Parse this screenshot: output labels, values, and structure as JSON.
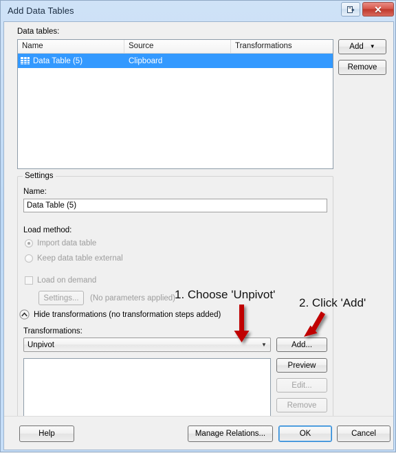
{
  "window": {
    "title": "Add Data Tables",
    "titlebar_buttons": [
      {
        "name": "context-help-button",
        "glyph": "❐"
      },
      {
        "name": "close-button",
        "glyph": "✕"
      }
    ]
  },
  "data_tables": {
    "section_label": "Data tables:",
    "columns": [
      "Name",
      "Source",
      "Transformations"
    ],
    "rows": [
      {
        "name": "Data Table (5)",
        "source": "Clipboard",
        "transformations": "",
        "selected": true
      }
    ],
    "buttons": {
      "add": "Add",
      "add_split_arrow": "▼",
      "remove": "Remove"
    }
  },
  "settings": {
    "group_title": "Settings",
    "name_label": "Name:",
    "name_value": "Data Table (5)",
    "load_method_label": "Load method:",
    "radios": [
      {
        "label": "Import data table",
        "checked": true,
        "disabled": true
      },
      {
        "label": "Keep data table external",
        "checked": false,
        "disabled": true
      }
    ],
    "load_on_demand": {
      "label": "Load on demand",
      "checked": false,
      "disabled": true
    },
    "settings_button": "Settings...",
    "parameters_note": "(No parameters applied)",
    "expander": "Hide transformations (no transformation steps added)",
    "transformations_label": "Transformations:",
    "transformation_selected": "Unpivot",
    "transformation_arrow": "▼",
    "transform_buttons": [
      {
        "label": "Add...",
        "disabled": false
      },
      {
        "label": "Preview",
        "disabled": false
      },
      {
        "label": "Edit...",
        "disabled": true
      },
      {
        "label": "Remove",
        "disabled": true
      }
    ],
    "transformation_list_items": []
  },
  "footer": {
    "help": "Help",
    "manage_relations": "Manage Relations...",
    "ok": "OK",
    "cancel": "Cancel"
  },
  "annotations": [
    {
      "text": "1. Choose 'Unpivot'"
    },
    {
      "text": "2. Click 'Add'"
    }
  ],
  "colors": {
    "selection_blue": "#3399ff",
    "annotation_arrow_red": "#c00000",
    "titlebar_blue": "#bcd8f5",
    "default_button_focus": "#2c86d6"
  }
}
